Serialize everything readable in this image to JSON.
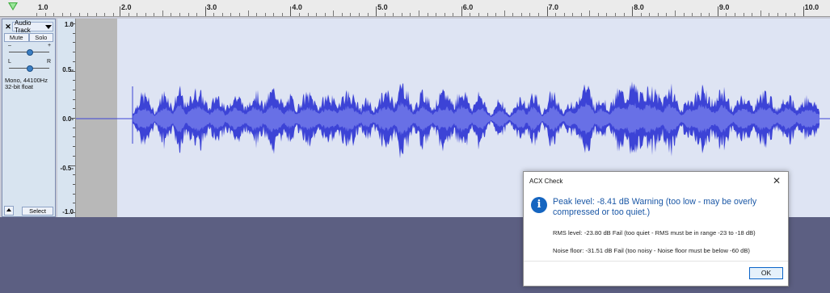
{
  "ruler": {
    "labels": [
      "1.0",
      "2.0",
      "3.0",
      "4.0",
      "5.0",
      "6.0",
      "7.0",
      "8.0",
      "9.0",
      "10.0"
    ]
  },
  "track": {
    "close_label": "✕",
    "name": "Audio Track",
    "mute_label": "Mute",
    "solo_label": "Solo",
    "gain_minus": "–",
    "gain_plus": "+",
    "pan_left": "L",
    "pan_right": "R",
    "info_line1": "Mono, 44100Hz",
    "info_line2": "32-bit float",
    "select_label": "Select"
  },
  "vscale": {
    "labels": [
      "1.0",
      "0.5-",
      "0.0-",
      "-0.5-",
      "-1.0"
    ]
  },
  "colors": {
    "waveform": "#3c43d6",
    "waveform_rms": "#6870e6",
    "info": "#1565c0"
  },
  "dialog": {
    "title": "ACX Check",
    "close_label": "✕",
    "peak_message": "Peak level:  -8.41 dB  Warning (too low - may be overly compressed or too quiet.)",
    "rms_line": "RMS level:  -23.80 dB  Fail (too quiet - RMS must be in range -23 to -18 dB)",
    "noise_line": "Noise floor:  -31.51 dB  Fail (too noisy - Noise floor must be below -60 dB)",
    "ok_label": "OK",
    "info_glyph": "i"
  }
}
